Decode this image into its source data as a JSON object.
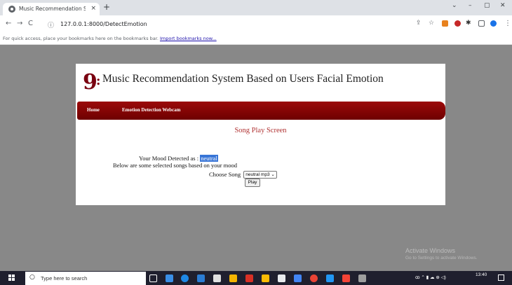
{
  "browser": {
    "tab_title": "Music Recommendation Systen",
    "tab_close": "×",
    "new_tab": "+",
    "window_controls": [
      "⌄",
      "–",
      "▢",
      "✕"
    ],
    "nav": {
      "back": "←",
      "forward": "→",
      "reload": "C"
    },
    "url": "127.0.0.1:8000/DetectEmotion",
    "info_icon": "ⓘ",
    "bookmarks_message": "For quick access, place your bookmarks here on the bookmarks bar.",
    "bookmarks_link": "Import bookmarks now...",
    "menu": "⋮",
    "colors": {
      "accent_red": "#7a0010",
      "mood_highlight": "#3875d7"
    }
  },
  "page": {
    "logo_char": "9",
    "logo_colon": ":",
    "heading": "Music Recommendation System Based on Users Facial Emotion",
    "nav_links": [
      "Home",
      "Emotion Detection Webcam"
    ],
    "screen_title": "Song Play Screen",
    "mood_prefix": "Your Mood Detected as :",
    "mood_value": "neutral",
    "below_text": "Below are some selected songs based on your mood",
    "choose_label": "Choose Song",
    "song_selected": "neutral mp3",
    "play_label": "Play"
  },
  "windows": {
    "activate_title": "Activate Windows",
    "activate_sub": "Go to Settings to activate Windows.",
    "search_placeholder": "Type here to search",
    "time": "13:40"
  }
}
